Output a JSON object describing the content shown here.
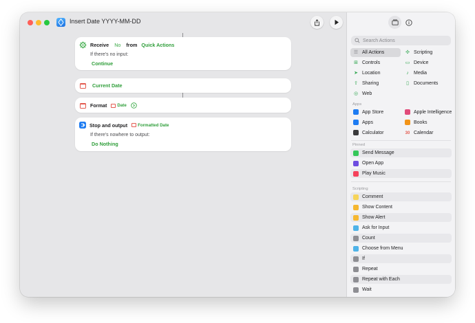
{
  "window": {
    "title": "Insert Date YYYY-MM-DD"
  },
  "toolbar": {
    "share_icon": "share-icon",
    "run_icon": "play-icon"
  },
  "workflow": {
    "receive": {
      "label": "Receive",
      "input_type": "No",
      "from_label": "from",
      "source": "Quick Actions",
      "no_input_label": "If there's no input:",
      "no_input_action": "Continue"
    },
    "current_date": {
      "label": "Current Date"
    },
    "format": {
      "label": "Format",
      "param": "Date"
    },
    "stop": {
      "label": "Stop and output",
      "param": "Formatted Date",
      "nowhere_label": "If there's nowhere to output:",
      "nowhere_action": "Do Nothing"
    }
  },
  "sidebar": {
    "search_placeholder": "Search Actions",
    "categories": [
      {
        "label": "All Actions",
        "icon": "list-icon",
        "color": "#8e8e93"
      },
      {
        "label": "Scripting",
        "icon": "scripting-icon",
        "color": "#34a853"
      },
      {
        "label": "Controls",
        "icon": "controls-icon",
        "color": "#34a853"
      },
      {
        "label": "Device",
        "icon": "device-icon",
        "color": "#34a853"
      },
      {
        "label": "Location",
        "icon": "location-icon",
        "color": "#34a853"
      },
      {
        "label": "Media",
        "icon": "music-icon",
        "color": "#34a853"
      },
      {
        "label": "Sharing",
        "icon": "sharing-icon",
        "color": "#34a853"
      },
      {
        "label": "Documents",
        "icon": "document-icon",
        "color": "#34a853"
      },
      {
        "label": "Web",
        "icon": "web-icon",
        "color": "#34a853"
      }
    ],
    "apps_label": "Apps",
    "apps": [
      {
        "label": "App Store",
        "icon": "app-store-icon",
        "color": "#1e7cf2"
      },
      {
        "label": "Apple Intelligence",
        "icon": "apple-intelligence-icon",
        "color": "#e14b7a"
      },
      {
        "label": "Apps",
        "icon": "apps-icon",
        "color": "#1e7cf2"
      },
      {
        "label": "Books",
        "icon": "books-icon",
        "color": "#f29418"
      },
      {
        "label": "Calculator",
        "icon": "calculator-icon",
        "color": "#3a3a3c"
      },
      {
        "label": "Calendar",
        "icon": "calendar-icon",
        "color": "#e35a4f"
      }
    ],
    "pinned_label": "Pinned",
    "pinned": [
      {
        "label": "Send Message",
        "icon": "message-icon",
        "color": "#35c759"
      },
      {
        "label": "Open App",
        "icon": "open-app-icon",
        "color": "#6e4de0"
      },
      {
        "label": "Play Music",
        "icon": "music-icon",
        "color": "#f5425c"
      }
    ],
    "scripting_label": "Scripting",
    "scripting": [
      {
        "label": "Comment",
        "icon": "comment-icon",
        "color": "#f6d45a"
      },
      {
        "label": "Show Content",
        "icon": "show-content-icon",
        "color": "#f5b730"
      },
      {
        "label": "Show Alert",
        "icon": "alert-icon",
        "color": "#f5b730"
      },
      {
        "label": "Ask for Input",
        "icon": "ask-input-icon",
        "color": "#4fb3e8"
      },
      {
        "label": "Count",
        "icon": "count-icon",
        "color": "#8e8e93"
      },
      {
        "label": "Choose from Menu",
        "icon": "menu-icon",
        "color": "#4fb3e8"
      },
      {
        "label": "If",
        "icon": "if-icon",
        "color": "#8e8e93"
      },
      {
        "label": "Repeat",
        "icon": "repeat-icon",
        "color": "#8e8e93"
      },
      {
        "label": "Repeat with Each",
        "icon": "repeat-each-icon",
        "color": "#8e8e93"
      },
      {
        "label": "Wait",
        "icon": "wait-icon",
        "color": "#8e8e93"
      }
    ]
  }
}
